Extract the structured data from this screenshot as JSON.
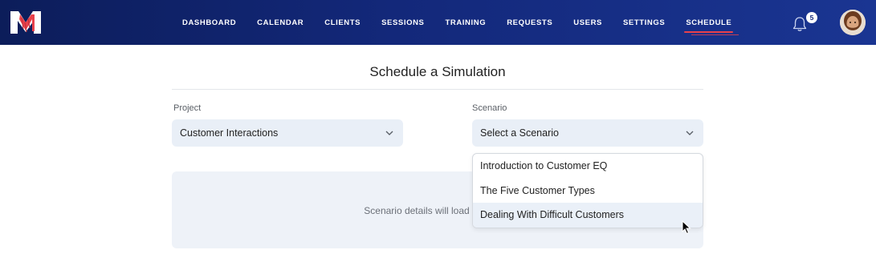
{
  "nav": {
    "items": [
      {
        "label": "DASHBOARD",
        "name": "nav-dashboard",
        "active": false
      },
      {
        "label": "CALENDAR",
        "name": "nav-calendar",
        "active": false
      },
      {
        "label": "CLIENTS",
        "name": "nav-clients",
        "active": false
      },
      {
        "label": "SESSIONS",
        "name": "nav-sessions",
        "active": false
      },
      {
        "label": "TRAINING",
        "name": "nav-training",
        "active": false
      },
      {
        "label": "REQUESTS",
        "name": "nav-requests",
        "active": false
      },
      {
        "label": "USERS",
        "name": "nav-users",
        "active": false
      },
      {
        "label": "SETTINGS",
        "name": "nav-settings",
        "active": false
      },
      {
        "label": "SCHEDULE",
        "name": "nav-schedule",
        "active": true
      }
    ],
    "notification_count": "5",
    "icons": {
      "logo": "brand-logo",
      "bell": "bell-icon",
      "avatar": "user-avatar"
    }
  },
  "colors": {
    "nav_bg": "#13287a",
    "active_underline": "#e8414b",
    "select_bg": "#e9eff7",
    "hover_bg": "#eaf0f8"
  },
  "page": {
    "title": "Schedule a Simulation"
  },
  "form": {
    "project": {
      "label": "Project",
      "value": "Customer Interactions"
    },
    "scenario": {
      "label": "Scenario",
      "value": "Select a Scenario",
      "options": [
        "Introduction to Customer EQ",
        "The Five Customer Types",
        "Dealing With Difficult Customers"
      ],
      "hovered_index": 2
    }
  },
  "details": {
    "placeholder": "Scenario details will load once you"
  }
}
